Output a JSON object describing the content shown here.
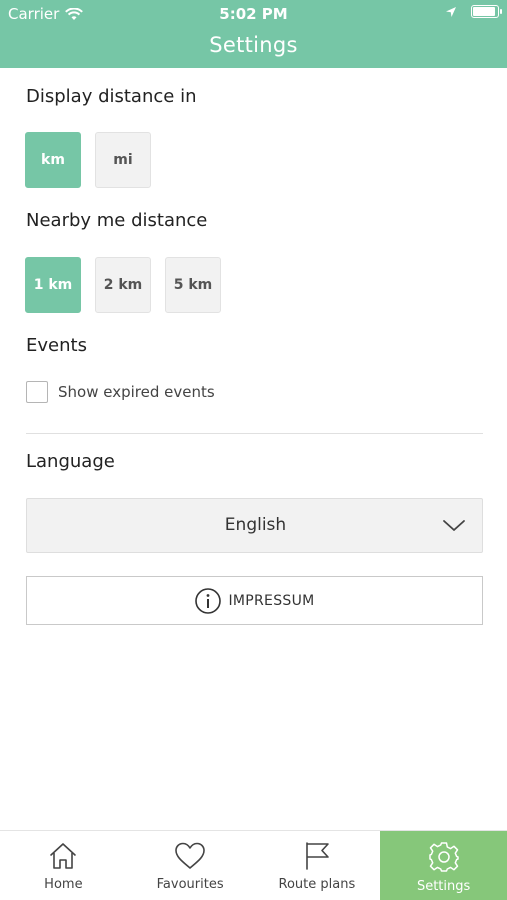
{
  "status_bar": {
    "carrier": "Carrier",
    "time": "5:02 PM",
    "battery_level": 0.95
  },
  "header": {
    "title": "Settings"
  },
  "sections": {
    "distance": {
      "title": "Display distance in",
      "options": [
        "km",
        "mi"
      ],
      "selected": "km"
    },
    "nearby": {
      "title": "Nearby me distance",
      "options": [
        "1 km",
        "2 km",
        "5 km"
      ],
      "selected": "1 km"
    },
    "events": {
      "title": "Events",
      "checkbox_label": "Show expired events",
      "checked": false
    },
    "language": {
      "title": "Language",
      "selected": "English"
    }
  },
  "impressum": {
    "label": "IMPRESSUM"
  },
  "tabbar": {
    "items": [
      {
        "label": "Home",
        "icon": "home-icon"
      },
      {
        "label": "Favourites",
        "icon": "heart-icon"
      },
      {
        "label": "Route plans",
        "icon": "flag-icon"
      },
      {
        "label": "Settings",
        "icon": "gear-icon"
      }
    ],
    "active": "Settings"
  },
  "colors": {
    "header": "#76c6a6",
    "option_active": "#76c6a6",
    "tab_active": "#86c77a"
  }
}
